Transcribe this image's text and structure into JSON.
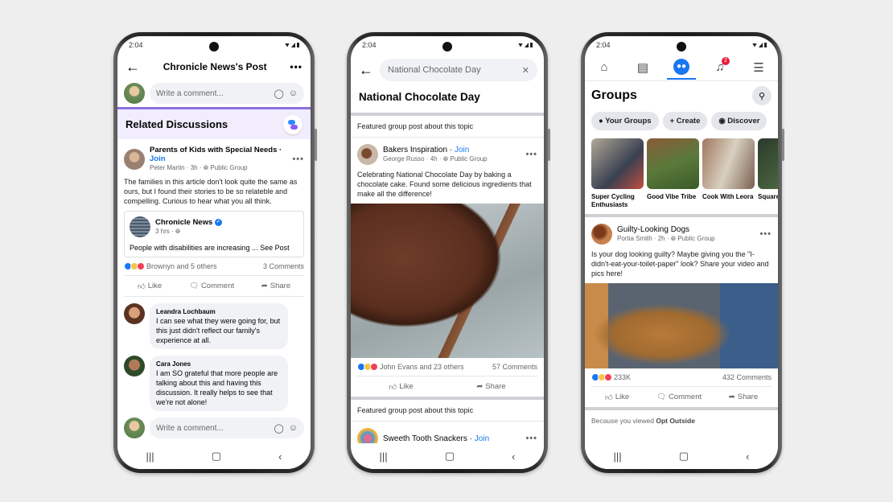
{
  "status_time": "2:04",
  "phone1": {
    "header": {
      "title": "Chronicle News's Post"
    },
    "comment_placeholder": "Write a comment...",
    "related": {
      "title": "Related Discussions"
    },
    "post": {
      "group": "Parents of Kids with Special Needs",
      "join": "Join",
      "author": "Peter Martin",
      "time": "3h",
      "privacy": "Public Group",
      "text": "The families in this article don't look quite the same as ours, but I found their stories to be so relateble and compelling. Curious to hear what you all think.",
      "shared": {
        "source": "Chronicle News",
        "time": "3 hrs",
        "text": "People with disabilities are increasing ... See Post"
      },
      "reactions": "Brownyn and 5 others",
      "comments_count": "3 Comments",
      "actions": {
        "like": "Like",
        "comment": "Comment",
        "share": "Share"
      }
    },
    "comments": [
      {
        "name": "Leandra Lochbaum",
        "text": "I can see what they were going for, but this just didn't reflect our family's experience at all."
      },
      {
        "name": "Cara Jones",
        "text": "I am SO grateful that more people are talking about this and having this discussion. It really helps to see that we're not alone!"
      }
    ]
  },
  "phone2": {
    "search": {
      "value": "National Chocolate Day"
    },
    "title": "National Chocolate Day",
    "featured_label": "Featured group post about this topic",
    "post": {
      "group": "Bakers Inspiration",
      "join": "Join",
      "author": "George Russo",
      "time": "4h",
      "privacy": "Public Group",
      "text": "Celebrating National Chocolate Day by baking a chocolate cake. Found some delicious ingredients that make all the difference!",
      "reactions": "John Evans and 23 others",
      "comments_count": "57 Comments",
      "actions": {
        "like": "Like",
        "share": "Share"
      }
    },
    "featured_label_2": "Featured group post about this topic",
    "post2": {
      "group": "Sweeth Tooth Snackers",
      "join": "Join"
    }
  },
  "phone3": {
    "notification_count": "2",
    "title": "Groups",
    "pills": [
      "Your Groups",
      "Create",
      "Discover"
    ],
    "groups": [
      {
        "name": "Super Cycling Enthusiasts"
      },
      {
        "name": "Good Vibe Tribe"
      },
      {
        "name": "Cook With Leora"
      },
      {
        "name": "Square Garde"
      }
    ],
    "post": {
      "group": "Guilty-Looking Dogs",
      "author": "Portia Smith",
      "time": "2h",
      "privacy": "Public Group",
      "text": "Is your dog looking guilty? Maybe giving you the \"I-didn't-eat-your-toilet-paper\" look? Share your video and pics here!",
      "reactions": "233K",
      "comments_count": "432 Comments",
      "actions": {
        "like": "Like",
        "comment": "Comment",
        "share": "Share"
      }
    },
    "because_prefix": "Because you viewed ",
    "because_topic": "Opt Outside"
  },
  "colors": {
    "accent": "#1877f2",
    "related_bg": "#f1edfc",
    "related_border": "#8b6fe0",
    "badge": "#e41e3f"
  }
}
